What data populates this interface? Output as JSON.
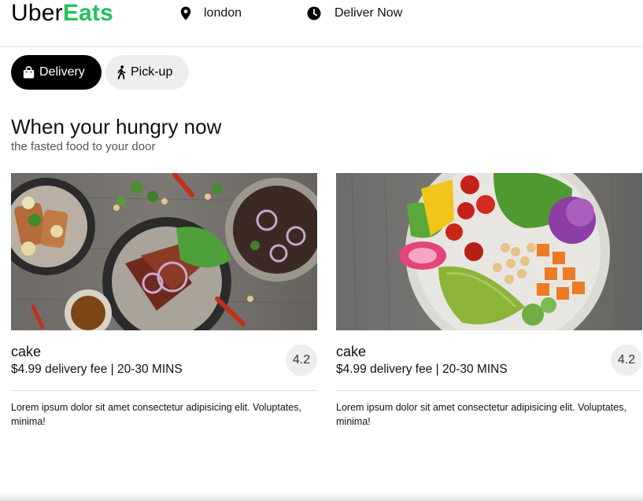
{
  "header": {
    "logo_part1": "Uber",
    "logo_part2": "Eats",
    "brand_color": "#22c25e",
    "location_icon": "location-pin-icon",
    "location": "london",
    "time_icon": "clock-icon",
    "deliver_time": "Deliver Now"
  },
  "mode_toggle": {
    "delivery": {
      "label": "Delivery",
      "icon": "shopping-bag-icon",
      "selected": true
    },
    "pickup": {
      "label": "Pick-up",
      "icon": "walking-person-icon",
      "selected": false
    }
  },
  "hero": {
    "title": "When your hungry now",
    "subtitle": "the fasted food to your door"
  },
  "cards": [
    {
      "name": "cake",
      "fee": "$4.99 delivery fee | 20-30 MINS",
      "rating": "4.2",
      "description": "Lorem ipsum dolor sit amet consectetur adipisicing elit. Voluptates, minima!"
    },
    {
      "name": "cake",
      "fee": "$4.99 delivery fee | 20-30 MINS",
      "rating": "4.2",
      "description": "Lorem ipsum dolor sit amet consectetur adipisicing elit. Voluptates, minima!"
    }
  ]
}
